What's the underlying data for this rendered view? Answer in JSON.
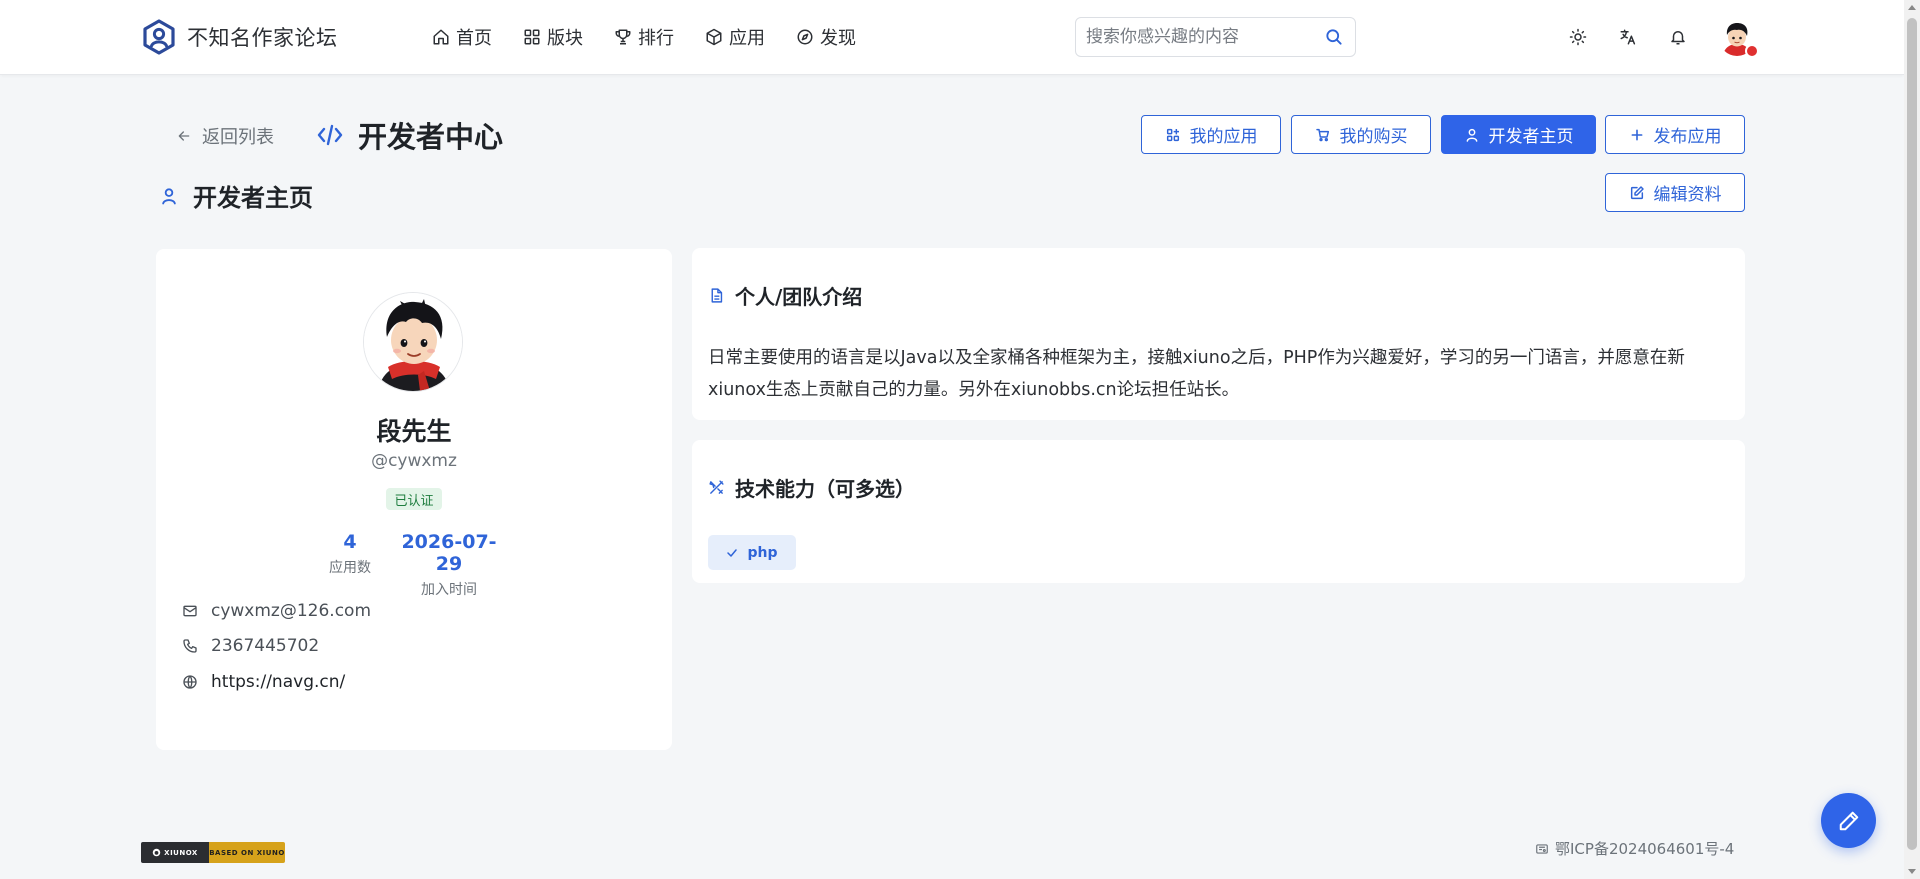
{
  "site": {
    "name": "不知名作家论坛",
    "logo_icon": "user-hexagon-logo-icon"
  },
  "nav": {
    "items": [
      {
        "label": "首页",
        "icon": "home-icon"
      },
      {
        "label": "版块",
        "icon": "grid-icon"
      },
      {
        "label": "排行",
        "icon": "trophy-icon"
      },
      {
        "label": "应用",
        "icon": "box-icon"
      },
      {
        "label": "发现",
        "icon": "compass-icon"
      }
    ]
  },
  "search": {
    "placeholder": "搜索你感兴趣的内容",
    "value": ""
  },
  "header_icons": [
    "sun-icon",
    "translate-icon",
    "bell-icon",
    "user-avatar"
  ],
  "page": {
    "back_label": "返回列表",
    "title": "开发者中心",
    "section_title": "开发者主页"
  },
  "actions": {
    "my_apps": "我的应用",
    "my_purchases": "我的购买",
    "dev_home": "开发者主页",
    "publish_app": "发布应用",
    "edit_profile": "编辑资料"
  },
  "profile": {
    "name": "段先生",
    "handle": "@cywxmz",
    "verified": "已认证",
    "stats": [
      {
        "value": "4",
        "label": "应用数"
      },
      {
        "value": "2026-07-29",
        "label": "加入时间"
      }
    ],
    "email": "cywxmz@126.com",
    "phone": "2367445702",
    "website": "https://navg.cn/"
  },
  "intro": {
    "title": "个人/团队介绍",
    "text": "日常主要使用的语言是以Java以及全家桶各种框架为主，接触xiuno之后，PHP作为兴趣爱好，学习的另一门语言，并愿意在新xiunox生态上贡献自己的力量。另外在xiunobbs.cn论坛担任站长。"
  },
  "skills": {
    "title": "技术能力（可多选）",
    "tags": [
      "php"
    ]
  },
  "footer": {
    "badge_left": "XIUNOX",
    "badge_right": "BASED ON XIUNO",
    "icp": "鄂ICP备2024064601号-4"
  },
  "colors": {
    "primary": "#2f64e8",
    "accent_text": "#2f64d8",
    "background": "#f4f6f8",
    "verified_bg": "#e3f4e8",
    "verified_text": "#1e7d3e",
    "badge_gold": "#d6a21b"
  }
}
